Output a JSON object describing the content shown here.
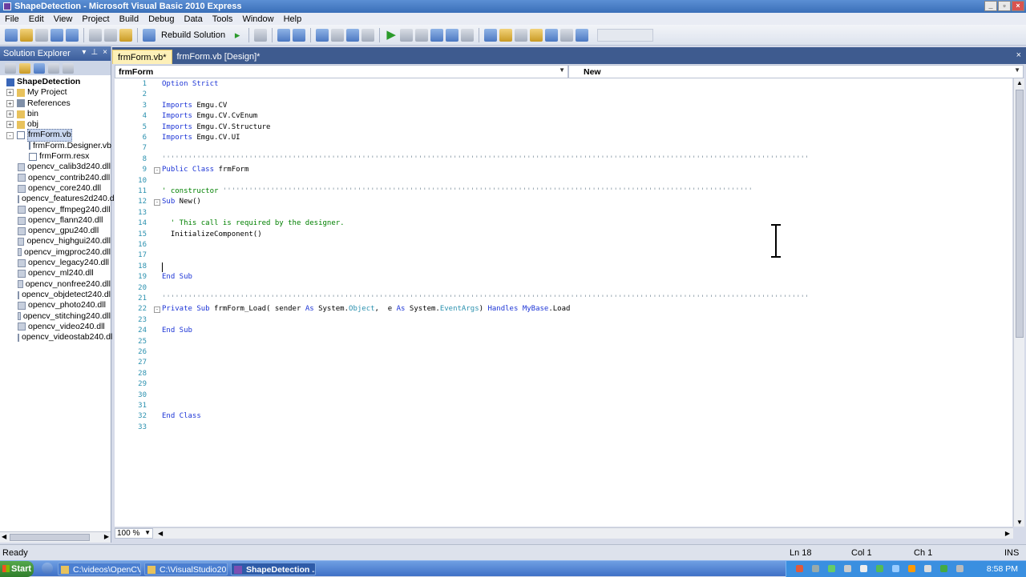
{
  "window": {
    "title": "ShapeDetection - Microsoft Visual Basic 2010 Express"
  },
  "menu": [
    "File",
    "Edit",
    "View",
    "Project",
    "Build",
    "Debug",
    "Data",
    "Tools",
    "Window",
    "Help"
  ],
  "toolbar": {
    "rebuild_label": "Rebuild Solution"
  },
  "solution_explorer": {
    "title": "Solution Explorer",
    "project": "ShapeDetection",
    "items": [
      {
        "label": "My Project",
        "icon": "folder-icon",
        "level": 1,
        "expander": "+"
      },
      {
        "label": "References",
        "icon": "references-icon",
        "level": 1,
        "expander": "+"
      },
      {
        "label": "bin",
        "icon": "folder-icon",
        "level": 1,
        "expander": "+"
      },
      {
        "label": "obj",
        "icon": "folder-icon",
        "level": 1,
        "expander": "+"
      },
      {
        "label": "frmForm.vb",
        "icon": "form-file-icon",
        "level": 1,
        "expander": "-",
        "selected": true
      },
      {
        "label": "frmForm.Designer.vb",
        "icon": "vb-file-icon",
        "level": 2
      },
      {
        "label": "frmForm.resx",
        "icon": "resx-file-icon",
        "level": 2
      },
      {
        "label": "opencv_calib3d240.dll",
        "icon": "dll-icon",
        "level": 1
      },
      {
        "label": "opencv_contrib240.dll",
        "icon": "dll-icon",
        "level": 1
      },
      {
        "label": "opencv_core240.dll",
        "icon": "dll-icon",
        "level": 1
      },
      {
        "label": "opencv_features2d240.d",
        "icon": "dll-icon",
        "level": 1
      },
      {
        "label": "opencv_ffmpeg240.dll",
        "icon": "dll-icon",
        "level": 1
      },
      {
        "label": "opencv_flann240.dll",
        "icon": "dll-icon",
        "level": 1
      },
      {
        "label": "opencv_gpu240.dll",
        "icon": "dll-icon",
        "level": 1
      },
      {
        "label": "opencv_highgui240.dll",
        "icon": "dll-icon",
        "level": 1
      },
      {
        "label": "opencv_imgproc240.dll",
        "icon": "dll-icon",
        "level": 1
      },
      {
        "label": "opencv_legacy240.dll",
        "icon": "dll-icon",
        "level": 1
      },
      {
        "label": "opencv_ml240.dll",
        "icon": "dll-icon",
        "level": 1
      },
      {
        "label": "opencv_nonfree240.dll",
        "icon": "dll-icon",
        "level": 1
      },
      {
        "label": "opencv_objdetect240.dl",
        "icon": "dll-icon",
        "level": 1
      },
      {
        "label": "opencv_photo240.dll",
        "icon": "dll-icon",
        "level": 1
      },
      {
        "label": "opencv_stitching240.dll",
        "icon": "dll-icon",
        "level": 1
      },
      {
        "label": "opencv_video240.dll",
        "icon": "dll-icon",
        "level": 1
      },
      {
        "label": "opencv_videostab240.dl",
        "icon": "dll-icon",
        "level": 1
      }
    ]
  },
  "tabs": [
    {
      "label": "frmForm.vb*",
      "active": true
    },
    {
      "label": "frmForm.vb [Design]*",
      "active": false
    }
  ],
  "navbar": {
    "class_combo": "frmForm",
    "method_combo": "New"
  },
  "code_lines": [
    {
      "n": "1",
      "seg": [
        [
          "kw",
          "Option Strict"
        ]
      ]
    },
    {
      "n": "2",
      "seg": []
    },
    {
      "n": "3",
      "seg": [
        [
          "kw",
          "Imports"
        ],
        [
          "tx",
          " Emgu.CV"
        ]
      ]
    },
    {
      "n": "4",
      "seg": [
        [
          "kw",
          "Imports"
        ],
        [
          "tx",
          " Emgu.CV.CvEnum"
        ]
      ]
    },
    {
      "n": "5",
      "seg": [
        [
          "kw",
          "Imports"
        ],
        [
          "tx",
          " Emgu.CV.Structure"
        ]
      ]
    },
    {
      "n": "6",
      "seg": [
        [
          "kw",
          "Imports"
        ],
        [
          "tx",
          " Emgu.CV.UI"
        ]
      ]
    },
    {
      "n": "7",
      "seg": []
    },
    {
      "n": "8",
      "seg": [
        [
          "dot",
          "'''''''''''''''''''''''''''''''''''''''''''''''''''''''''''''''''''''''''''''''''''''''''''''''''''''''''''''''''''''''''''''''''''''''''''''''''''''"
        ]
      ]
    },
    {
      "n": "9",
      "seg": [
        [
          "kw",
          "Public Class"
        ],
        [
          "tx",
          " frmForm"
        ]
      ],
      "fold": "-"
    },
    {
      "n": "10",
      "seg": []
    },
    {
      "n": "11",
      "seg": [
        [
          "cm",
          "' constructor "
        ],
        [
          "dot",
          "''''''''''''''''''''''''''''''''''''''''''''''''''''''''''''''''''''''''''''''''''''''''''''''''''''''''''''''''''''''''''"
        ]
      ]
    },
    {
      "n": "12",
      "seg": [
        [
          "kw",
          "Sub"
        ],
        [
          "tx",
          " New()"
        ]
      ],
      "fold": "-"
    },
    {
      "n": "13",
      "seg": []
    },
    {
      "n": "14",
      "seg": [
        [
          "cm",
          "  ' This call is required by the designer."
        ]
      ]
    },
    {
      "n": "15",
      "seg": [
        [
          "tx",
          "  InitializeComponent()"
        ]
      ]
    },
    {
      "n": "16",
      "seg": []
    },
    {
      "n": "17",
      "seg": []
    },
    {
      "n": "18",
      "seg": [],
      "caret": true
    },
    {
      "n": "19",
      "seg": [
        [
          "kw",
          "End Sub"
        ]
      ]
    },
    {
      "n": "20",
      "seg": []
    },
    {
      "n": "21",
      "seg": [
        [
          "dot",
          "'''''''''''''''''''''''''''''''''''''''''''''''''''''''''''''''''''''''''''''''''''''''''''''''''''''''''''''''''''''''''''''''''''''''''''''''''''''"
        ]
      ]
    },
    {
      "n": "22",
      "seg": [
        [
          "kw",
          "Private Sub"
        ],
        [
          "tx",
          " frmForm_Load( sender "
        ],
        [
          "kw",
          "As"
        ],
        [
          "tx",
          " System."
        ],
        [
          "ty",
          "Object"
        ],
        [
          "tx",
          ",  e "
        ],
        [
          "kw",
          "As"
        ],
        [
          "tx",
          " System."
        ],
        [
          "ty",
          "EventArgs"
        ],
        [
          "tx",
          ") "
        ],
        [
          "kw",
          "Handles"
        ],
        [
          "tx",
          " "
        ],
        [
          "kw",
          "MyBase"
        ],
        [
          "tx",
          ".Load"
        ]
      ],
      "fold": "-"
    },
    {
      "n": "23",
      "seg": []
    },
    {
      "n": "24",
      "seg": [
        [
          "kw",
          "End Sub"
        ]
      ]
    },
    {
      "n": "25",
      "seg": []
    },
    {
      "n": "26",
      "seg": []
    },
    {
      "n": "27",
      "seg": []
    },
    {
      "n": "28",
      "seg": []
    },
    {
      "n": "29",
      "seg": []
    },
    {
      "n": "30",
      "seg": []
    },
    {
      "n": "31",
      "seg": []
    },
    {
      "n": "32",
      "seg": [
        [
          "kw",
          "End Class"
        ]
      ]
    },
    {
      "n": "33",
      "seg": []
    }
  ],
  "colors": {
    "keyword": "#1d35d6",
    "comment": "#008000",
    "type": "#2b91af",
    "line_number": "#2b91af"
  },
  "zoom": "100 %",
  "status": {
    "text": "Ready",
    "line": "Ln 18",
    "col": "Col 1",
    "ch": "Ch 1",
    "mode": "INS"
  },
  "taskbar": {
    "start": "Start",
    "tasks": [
      {
        "label": "C:\\videos\\OpenCV..."
      },
      {
        "label": "C:\\VisualStudio201..."
      },
      {
        "label": "ShapeDetection ..."
      }
    ],
    "clock": "8:58 PM"
  }
}
